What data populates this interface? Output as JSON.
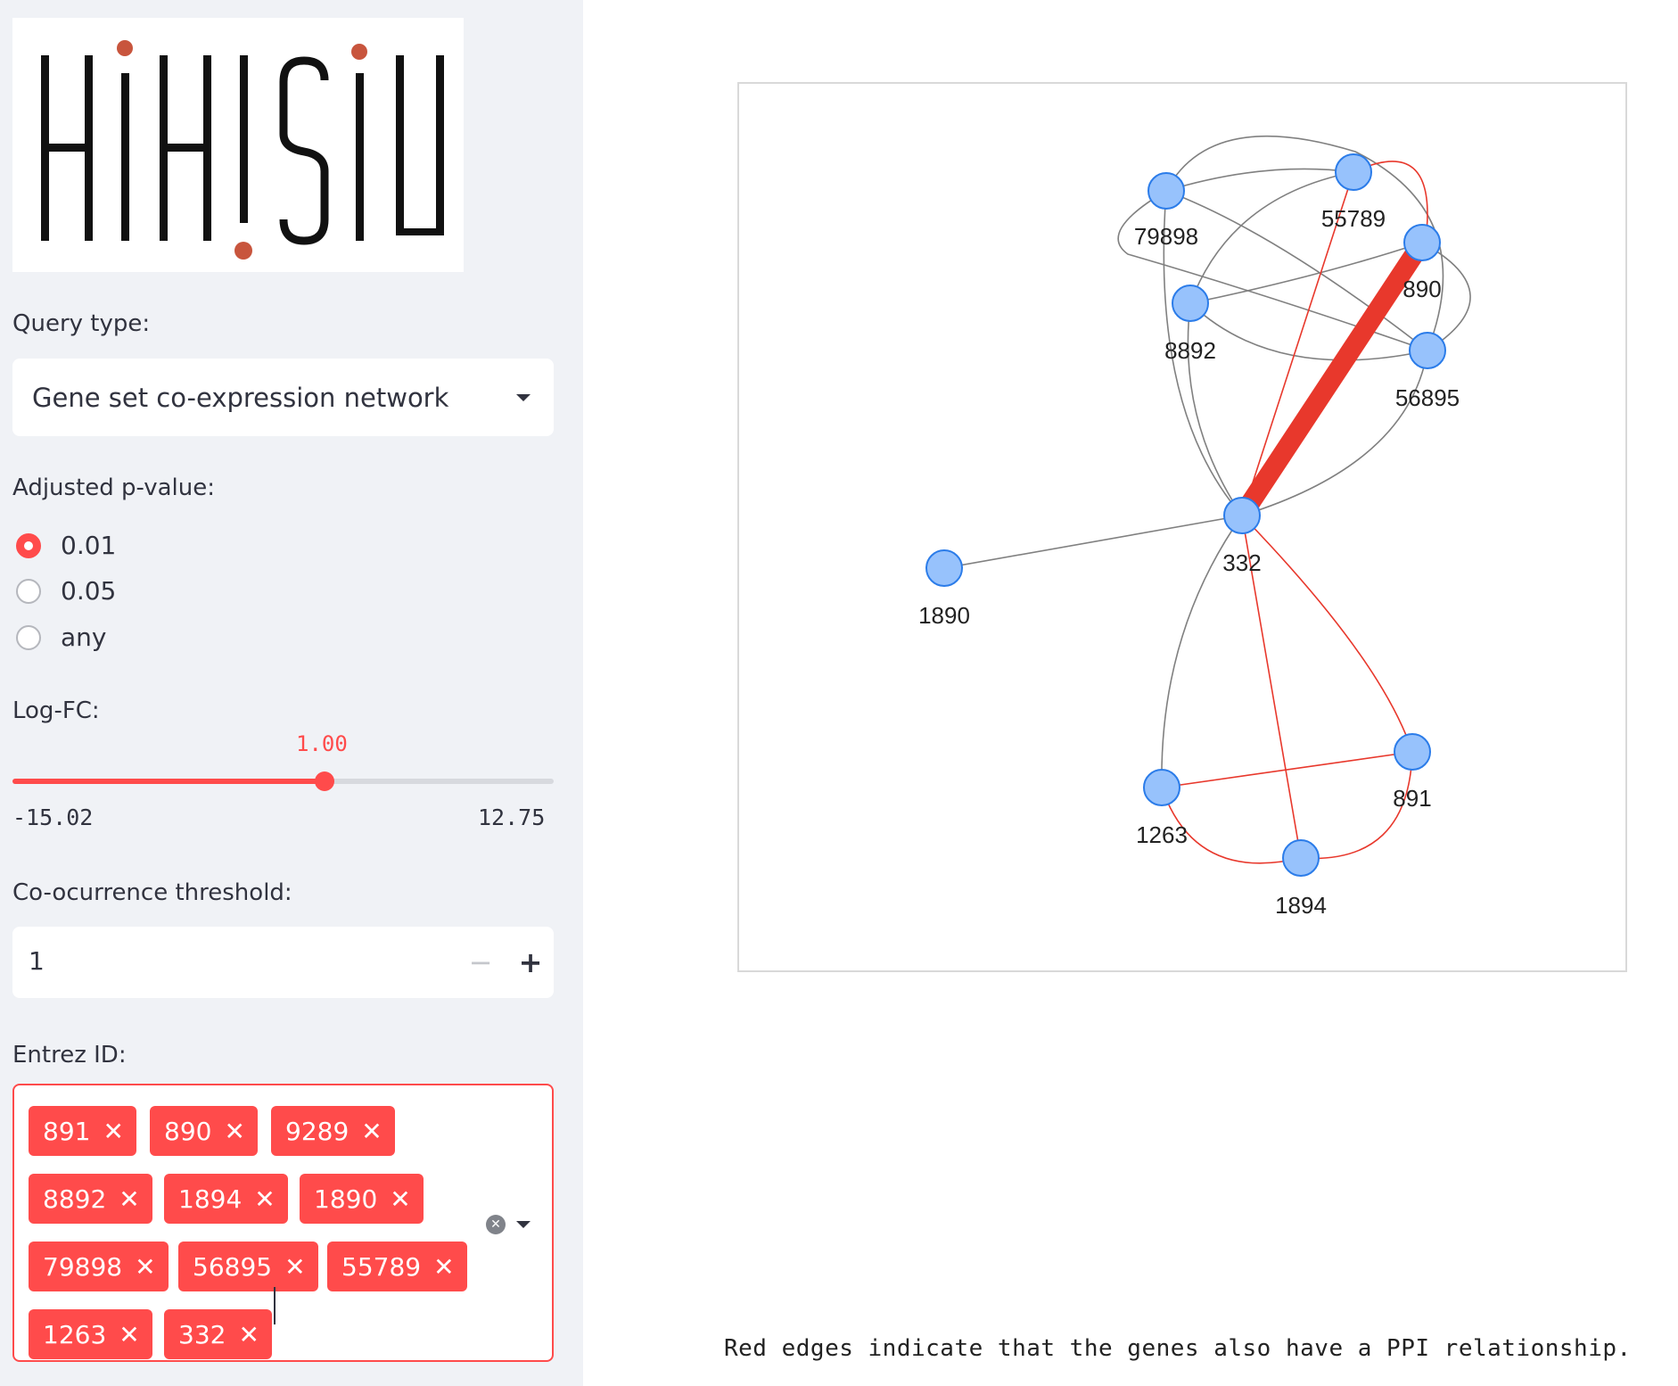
{
  "sidebar": {
    "logo_alt": "HIHISIV",
    "query_type": {
      "label": "Query type:",
      "selected": "Gene set co-expression network"
    },
    "pvalue": {
      "label": "Adjusted p-value:",
      "options": [
        "0.01",
        "0.05",
        "any"
      ],
      "selected": "0.01"
    },
    "logfc": {
      "label": "Log-FC:",
      "value": "1.00",
      "min": "-15.02",
      "max": "12.75",
      "value_num": 1.0,
      "min_num": -15.02,
      "max_num": 12.75
    },
    "cooccurrence": {
      "label": "Co-ocurrence threshold:",
      "value": "1",
      "minus": "−",
      "plus": "+"
    },
    "entrez": {
      "label": "Entrez ID:",
      "tags": [
        "891",
        "890",
        "9289",
        "8892",
        "1894",
        "1890",
        "79898",
        "56895",
        "55789",
        "1263",
        "332"
      ]
    }
  },
  "network": {
    "nodes": [
      "79898",
      "55789",
      "890",
      "8892",
      "56895",
      "332",
      "1890",
      "891",
      "1263",
      "1894"
    ],
    "caption": "Red edges indicate that the genes also have a PPI relationship."
  },
  "colors": {
    "accent": "#ff4b4b",
    "node_fill": "#97c2fc",
    "node_stroke": "#2b7ce9",
    "edge_gray": "#808080",
    "edge_red": "#e8382c"
  }
}
